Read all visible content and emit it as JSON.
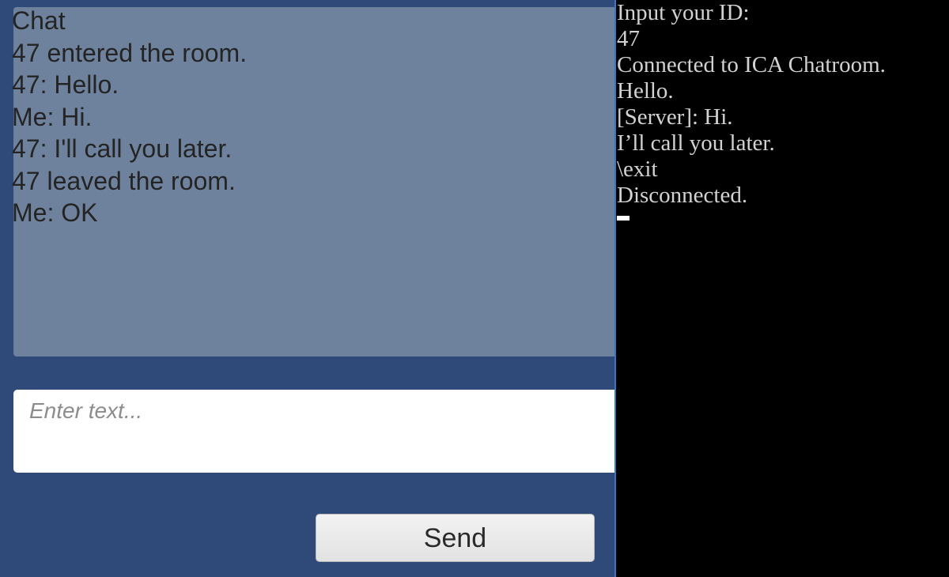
{
  "chat": {
    "log_lines": [
      "Chat",
      "47 entered the room.",
      "47: Hello.",
      "Me: Hi.",
      "47: I'll call you later.",
      "47 leaved the room.",
      "Me: OK"
    ],
    "input_placeholder": "Enter text...",
    "send_label": "Send"
  },
  "console": {
    "lines": [
      "Input your ID:",
      "47",
      "Connected to ICA Chatroom.",
      "Hello.",
      "[Server]: Hi.",
      "I’ll call you later.",
      "\\exit",
      "Disconnected."
    ]
  },
  "colors": {
    "app_background": "#2f4a78",
    "chat_log_background": "#6e829d",
    "console_background": "#000000",
    "console_text": "#d2d2d2"
  }
}
